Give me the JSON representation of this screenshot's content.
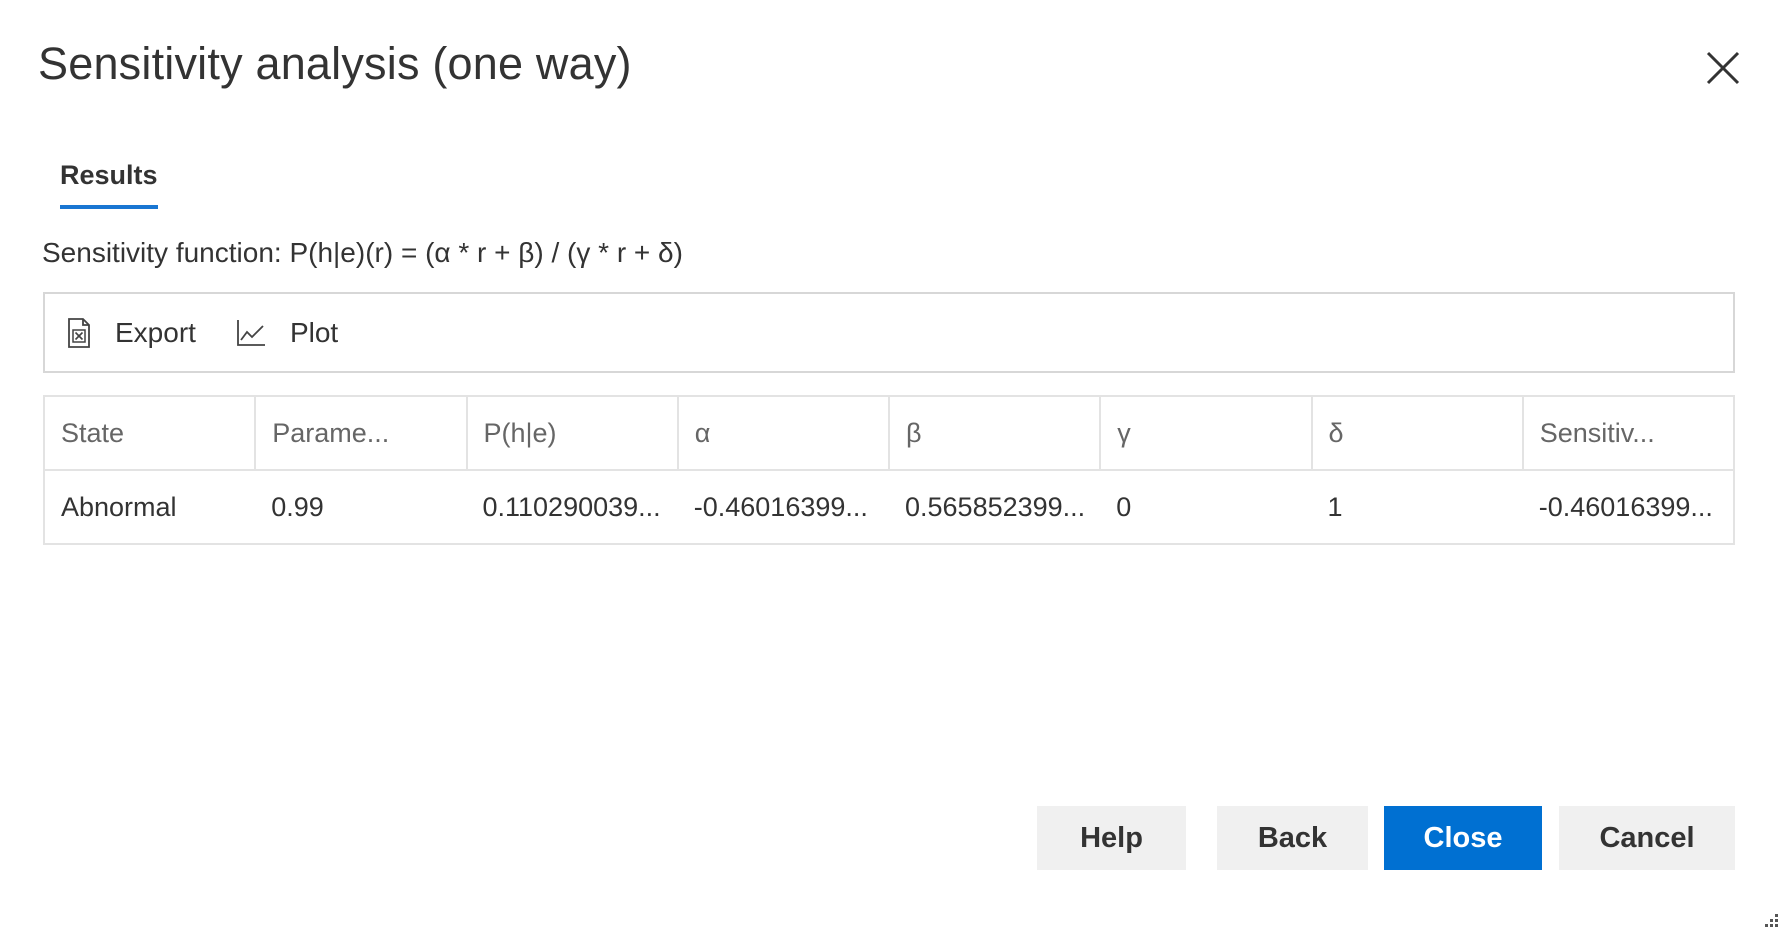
{
  "dialog": {
    "title": "Sensitivity analysis (one way)"
  },
  "tabs": [
    {
      "label": "Results",
      "active": true
    }
  ],
  "sensitivity_function": "Sensitivity function: P(h|e)(r) = (α * r + β) / (γ * r + δ)",
  "toolbar": {
    "export_label": "Export",
    "export_icon": "excel-file-icon",
    "plot_label": "Plot",
    "plot_icon": "line-chart-icon"
  },
  "table": {
    "columns": [
      "State",
      "Parame...",
      "P(h|e)",
      "α",
      "β",
      "γ",
      "δ",
      "Sensitiv..."
    ],
    "rows": [
      [
        "Abnormal",
        "0.99",
        "0.110290039...",
        "-0.46016399...",
        "0.565852399...",
        "0",
        "1",
        "-0.46016399..."
      ]
    ]
  },
  "buttons": {
    "help": "Help",
    "back": "Back",
    "close": "Close",
    "cancel": "Cancel"
  },
  "colors": {
    "accent": "#0070d2",
    "tab_underline": "#1976d2"
  }
}
